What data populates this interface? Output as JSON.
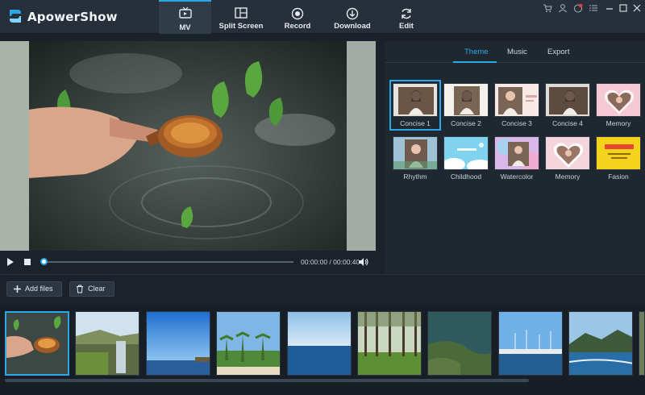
{
  "app": {
    "brand": "ApowerShow",
    "accent_color": "#2aa9e8"
  },
  "nav": {
    "tabs": [
      {
        "label": "MV",
        "icon": "tv-icon",
        "active": true
      },
      {
        "label": "Split Screen",
        "icon": "split-screen-icon",
        "active": false
      },
      {
        "label": "Record",
        "icon": "record-icon",
        "active": false
      },
      {
        "label": "Download",
        "icon": "download-icon",
        "active": false
      },
      {
        "label": "Edit",
        "icon": "refresh-icon",
        "active": false
      }
    ]
  },
  "window_controls": [
    "cart-icon",
    "user-icon",
    "notification-icon",
    "menu-icon",
    "minimize-icon",
    "maximize-icon",
    "close-icon"
  ],
  "player": {
    "timecode": "00:00:00 / 00:00:40",
    "progress": 0
  },
  "panel": {
    "tabs": [
      {
        "label": "Theme",
        "active": true
      },
      {
        "label": "Music",
        "active": false
      },
      {
        "label": "Export",
        "active": false
      }
    ],
    "themes": [
      {
        "name": "Concise 1",
        "selected": true
      },
      {
        "name": "Concise 2",
        "selected": false
      },
      {
        "name": "Concise 3",
        "selected": false
      },
      {
        "name": "Concise 4",
        "selected": false
      },
      {
        "name": "Memory",
        "selected": false
      },
      {
        "name": "Rhythm",
        "selected": false
      },
      {
        "name": "Childhood",
        "selected": false
      },
      {
        "name": "Watercolor",
        "selected": false
      },
      {
        "name": "Memory",
        "selected": false
      },
      {
        "name": "Fasion",
        "selected": false
      }
    ]
  },
  "toolbar": {
    "add_files_label": "Add files",
    "clear_label": "Clear"
  },
  "filmstrip": {
    "clips": [
      {
        "subject": "hand-scoop-water",
        "selected": true
      },
      {
        "subject": "waterfall-cliff",
        "selected": false
      },
      {
        "subject": "blue-sky-coast",
        "selected": false
      },
      {
        "subject": "palm-beach",
        "selected": false
      },
      {
        "subject": "ocean-horizon",
        "selected": false
      },
      {
        "subject": "forest-trees",
        "selected": false
      },
      {
        "subject": "rocky-shore",
        "selected": false
      },
      {
        "subject": "marina-boats",
        "selected": false
      },
      {
        "subject": "mountain-bay",
        "selected": false
      }
    ]
  }
}
